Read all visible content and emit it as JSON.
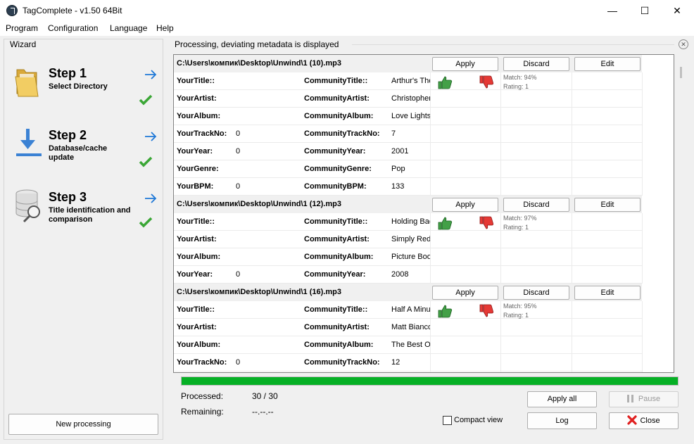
{
  "window": {
    "title": "TagComplete - v1.50 64Bit",
    "minimize_glyph": "—",
    "maximize_glyph": "☐",
    "close_glyph": "✕"
  },
  "menu": [
    "Program",
    "Configuration",
    "Language",
    "Help"
  ],
  "wizard": {
    "legend": "Wizard",
    "steps": [
      {
        "title": "Step 1",
        "subtitle": "Select Directory",
        "icon": "folder-icon",
        "done": true
      },
      {
        "title": "Step 2",
        "subtitle": "Database/cache update",
        "icon": "download-icon",
        "done": true
      },
      {
        "title": "Step 3",
        "subtitle": "Title identification and comparison",
        "icon": "database-search-icon",
        "done": true
      }
    ],
    "new_processing_label": "New processing"
  },
  "processing": {
    "header": "Processing, deviating metadata is displayed",
    "apply_label": "Apply",
    "discard_label": "Discard",
    "edit_label": "Edit",
    "files": [
      {
        "path": "C:\\Users\\компик\\Desktop\\Unwind\\1 (10).mp3",
        "match": "Match: 94%",
        "rating": "Rating: 1",
        "rows": [
          {
            "your_label": "YourTitle::",
            "your_value": "",
            "comm_label": "CommunityTitle::",
            "comm_value": "Arthur's Theme"
          },
          {
            "your_label": "YourArtist:",
            "your_value": "",
            "comm_label": "CommunityArtist:",
            "comm_value": "Christopher Cross"
          },
          {
            "your_label": "YourAlbum:",
            "your_value": "",
            "comm_label": "CommunityAlbum:",
            "comm_value": "Love Lights"
          },
          {
            "your_label": "YourTrackNo:",
            "your_value": "0",
            "comm_label": "CommunityTrackNo:",
            "comm_value": "7"
          },
          {
            "your_label": "YourYear:",
            "your_value": "0",
            "comm_label": "CommunityYear:",
            "comm_value": "2001"
          },
          {
            "your_label": "YourGenre:",
            "your_value": "",
            "comm_label": "CommunityGenre:",
            "comm_value": "Pop"
          },
          {
            "your_label": "YourBPM:",
            "your_value": "0",
            "comm_label": "CommunityBPM:",
            "comm_value": "133"
          }
        ]
      },
      {
        "path": "C:\\Users\\компик\\Desktop\\Unwind\\1 (12).mp3",
        "match": "Match: 97%",
        "rating": "Rating: 1",
        "rows": [
          {
            "your_label": "YourTitle::",
            "your_value": "",
            "comm_label": "CommunityTitle::",
            "comm_value": "Holding Back the Years"
          },
          {
            "your_label": "YourArtist:",
            "your_value": "",
            "comm_label": "CommunityArtist:",
            "comm_value": "Simply Red"
          },
          {
            "your_label": "YourAlbum:",
            "your_value": "",
            "comm_label": "CommunityAlbum:",
            "comm_value": "Picture Book"
          },
          {
            "your_label": "YourYear:",
            "your_value": "0",
            "comm_label": "CommunityYear:",
            "comm_value": "2008"
          }
        ]
      },
      {
        "path": "C:\\Users\\компик\\Desktop\\Unwind\\1 (16).mp3",
        "match": "Match: 95%",
        "rating": "Rating: 1",
        "rows": [
          {
            "your_label": "YourTitle::",
            "your_value": "",
            "comm_label": "CommunityTitle::",
            "comm_value": "Half A Minute"
          },
          {
            "your_label": "YourArtist:",
            "your_value": "",
            "comm_label": "CommunityArtist:",
            "comm_value": "Matt Bianco"
          },
          {
            "your_label": "YourAlbum:",
            "your_value": "",
            "comm_label": "CommunityAlbum:",
            "comm_value": "The Best Of"
          },
          {
            "your_label": "YourTrackNo:",
            "your_value": "0",
            "comm_label": "CommunityTrackNo:",
            "comm_value": "12"
          }
        ]
      }
    ]
  },
  "progress": {
    "fraction": 1.0,
    "color": "#06b025"
  },
  "status": {
    "processed_label": "Processed:",
    "processed_value": "30 / 30",
    "remaining_label": "Remaining:",
    "remaining_value": "--.--.--"
  },
  "actions": {
    "apply_all": "Apply all",
    "pause": "Pause",
    "compact_view": "Compact view",
    "log": "Log",
    "close": "Close"
  }
}
